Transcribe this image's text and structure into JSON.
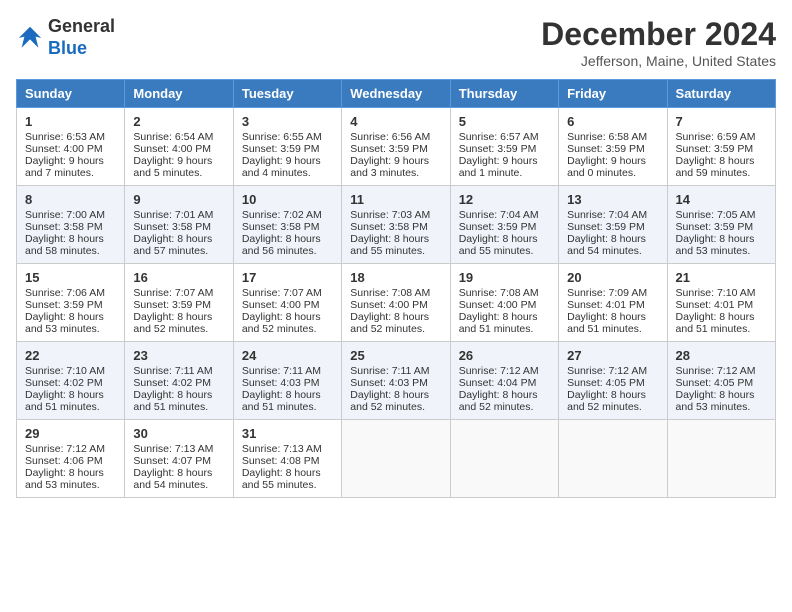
{
  "header": {
    "logo_line1": "General",
    "logo_line2": "Blue",
    "title": "December 2024",
    "location": "Jefferson, Maine, United States"
  },
  "days_of_week": [
    "Sunday",
    "Monday",
    "Tuesday",
    "Wednesday",
    "Thursday",
    "Friday",
    "Saturday"
  ],
  "weeks": [
    [
      {
        "day": "1",
        "lines": [
          "Sunrise: 6:53 AM",
          "Sunset: 4:00 PM",
          "Daylight: 9 hours",
          "and 7 minutes."
        ]
      },
      {
        "day": "2",
        "lines": [
          "Sunrise: 6:54 AM",
          "Sunset: 4:00 PM",
          "Daylight: 9 hours",
          "and 5 minutes."
        ]
      },
      {
        "day": "3",
        "lines": [
          "Sunrise: 6:55 AM",
          "Sunset: 3:59 PM",
          "Daylight: 9 hours",
          "and 4 minutes."
        ]
      },
      {
        "day": "4",
        "lines": [
          "Sunrise: 6:56 AM",
          "Sunset: 3:59 PM",
          "Daylight: 9 hours",
          "and 3 minutes."
        ]
      },
      {
        "day": "5",
        "lines": [
          "Sunrise: 6:57 AM",
          "Sunset: 3:59 PM",
          "Daylight: 9 hours",
          "and 1 minute."
        ]
      },
      {
        "day": "6",
        "lines": [
          "Sunrise: 6:58 AM",
          "Sunset: 3:59 PM",
          "Daylight: 9 hours",
          "and 0 minutes."
        ]
      },
      {
        "day": "7",
        "lines": [
          "Sunrise: 6:59 AM",
          "Sunset: 3:59 PM",
          "Daylight: 8 hours",
          "and 59 minutes."
        ]
      }
    ],
    [
      {
        "day": "8",
        "lines": [
          "Sunrise: 7:00 AM",
          "Sunset: 3:58 PM",
          "Daylight: 8 hours",
          "and 58 minutes."
        ]
      },
      {
        "day": "9",
        "lines": [
          "Sunrise: 7:01 AM",
          "Sunset: 3:58 PM",
          "Daylight: 8 hours",
          "and 57 minutes."
        ]
      },
      {
        "day": "10",
        "lines": [
          "Sunrise: 7:02 AM",
          "Sunset: 3:58 PM",
          "Daylight: 8 hours",
          "and 56 minutes."
        ]
      },
      {
        "day": "11",
        "lines": [
          "Sunrise: 7:03 AM",
          "Sunset: 3:58 PM",
          "Daylight: 8 hours",
          "and 55 minutes."
        ]
      },
      {
        "day": "12",
        "lines": [
          "Sunrise: 7:04 AM",
          "Sunset: 3:59 PM",
          "Daylight: 8 hours",
          "and 55 minutes."
        ]
      },
      {
        "day": "13",
        "lines": [
          "Sunrise: 7:04 AM",
          "Sunset: 3:59 PM",
          "Daylight: 8 hours",
          "and 54 minutes."
        ]
      },
      {
        "day": "14",
        "lines": [
          "Sunrise: 7:05 AM",
          "Sunset: 3:59 PM",
          "Daylight: 8 hours",
          "and 53 minutes."
        ]
      }
    ],
    [
      {
        "day": "15",
        "lines": [
          "Sunrise: 7:06 AM",
          "Sunset: 3:59 PM",
          "Daylight: 8 hours",
          "and 53 minutes."
        ]
      },
      {
        "day": "16",
        "lines": [
          "Sunrise: 7:07 AM",
          "Sunset: 3:59 PM",
          "Daylight: 8 hours",
          "and 52 minutes."
        ]
      },
      {
        "day": "17",
        "lines": [
          "Sunrise: 7:07 AM",
          "Sunset: 4:00 PM",
          "Daylight: 8 hours",
          "and 52 minutes."
        ]
      },
      {
        "day": "18",
        "lines": [
          "Sunrise: 7:08 AM",
          "Sunset: 4:00 PM",
          "Daylight: 8 hours",
          "and 52 minutes."
        ]
      },
      {
        "day": "19",
        "lines": [
          "Sunrise: 7:08 AM",
          "Sunset: 4:00 PM",
          "Daylight: 8 hours",
          "and 51 minutes."
        ]
      },
      {
        "day": "20",
        "lines": [
          "Sunrise: 7:09 AM",
          "Sunset: 4:01 PM",
          "Daylight: 8 hours",
          "and 51 minutes."
        ]
      },
      {
        "day": "21",
        "lines": [
          "Sunrise: 7:10 AM",
          "Sunset: 4:01 PM",
          "Daylight: 8 hours",
          "and 51 minutes."
        ]
      }
    ],
    [
      {
        "day": "22",
        "lines": [
          "Sunrise: 7:10 AM",
          "Sunset: 4:02 PM",
          "Daylight: 8 hours",
          "and 51 minutes."
        ]
      },
      {
        "day": "23",
        "lines": [
          "Sunrise: 7:11 AM",
          "Sunset: 4:02 PM",
          "Daylight: 8 hours",
          "and 51 minutes."
        ]
      },
      {
        "day": "24",
        "lines": [
          "Sunrise: 7:11 AM",
          "Sunset: 4:03 PM",
          "Daylight: 8 hours",
          "and 51 minutes."
        ]
      },
      {
        "day": "25",
        "lines": [
          "Sunrise: 7:11 AM",
          "Sunset: 4:03 PM",
          "Daylight: 8 hours",
          "and 52 minutes."
        ]
      },
      {
        "day": "26",
        "lines": [
          "Sunrise: 7:12 AM",
          "Sunset: 4:04 PM",
          "Daylight: 8 hours",
          "and 52 minutes."
        ]
      },
      {
        "day": "27",
        "lines": [
          "Sunrise: 7:12 AM",
          "Sunset: 4:05 PM",
          "Daylight: 8 hours",
          "and 52 minutes."
        ]
      },
      {
        "day": "28",
        "lines": [
          "Sunrise: 7:12 AM",
          "Sunset: 4:05 PM",
          "Daylight: 8 hours",
          "and 53 minutes."
        ]
      }
    ],
    [
      {
        "day": "29",
        "lines": [
          "Sunrise: 7:12 AM",
          "Sunset: 4:06 PM",
          "Daylight: 8 hours",
          "and 53 minutes."
        ]
      },
      {
        "day": "30",
        "lines": [
          "Sunrise: 7:13 AM",
          "Sunset: 4:07 PM",
          "Daylight: 8 hours",
          "and 54 minutes."
        ]
      },
      {
        "day": "31",
        "lines": [
          "Sunrise: 7:13 AM",
          "Sunset: 4:08 PM",
          "Daylight: 8 hours",
          "and 55 minutes."
        ]
      },
      {
        "day": "",
        "lines": []
      },
      {
        "day": "",
        "lines": []
      },
      {
        "day": "",
        "lines": []
      },
      {
        "day": "",
        "lines": []
      }
    ]
  ]
}
